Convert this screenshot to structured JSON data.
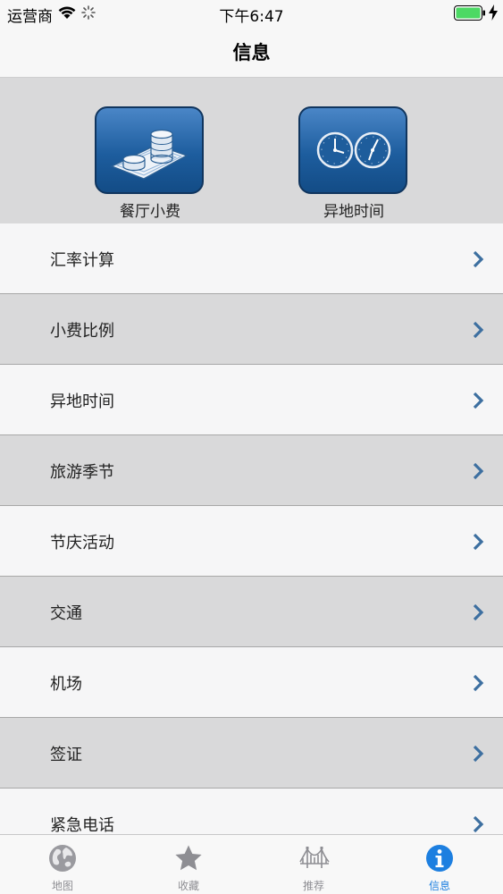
{
  "status_bar": {
    "carrier": "运营商",
    "time": "下午6:47"
  },
  "nav": {
    "title": "信息"
  },
  "features": [
    {
      "label": "餐厅小费",
      "icon": "coins-on-bills-icon"
    },
    {
      "label": "异地时间",
      "icon": "dual-clock-icon"
    }
  ],
  "list": [
    {
      "label": "汇率计算"
    },
    {
      "label": "小费比例"
    },
    {
      "label": "异地时间"
    },
    {
      "label": "旅游季节"
    },
    {
      "label": "节庆活动"
    },
    {
      "label": "交通"
    },
    {
      "label": "机场"
    },
    {
      "label": "签证"
    },
    {
      "label": "紧急电话"
    }
  ],
  "tabs": [
    {
      "label": "地图",
      "icon": "globe-icon",
      "active": false
    },
    {
      "label": "收藏",
      "icon": "star-icon",
      "active": false
    },
    {
      "label": "推荐",
      "icon": "bridge-icon",
      "active": false
    },
    {
      "label": "信息",
      "icon": "info-icon",
      "active": true
    }
  ],
  "colors": {
    "accent": "#1d7fe0",
    "chevron": "#3d6fa0",
    "tile": "#1d5d9e"
  }
}
